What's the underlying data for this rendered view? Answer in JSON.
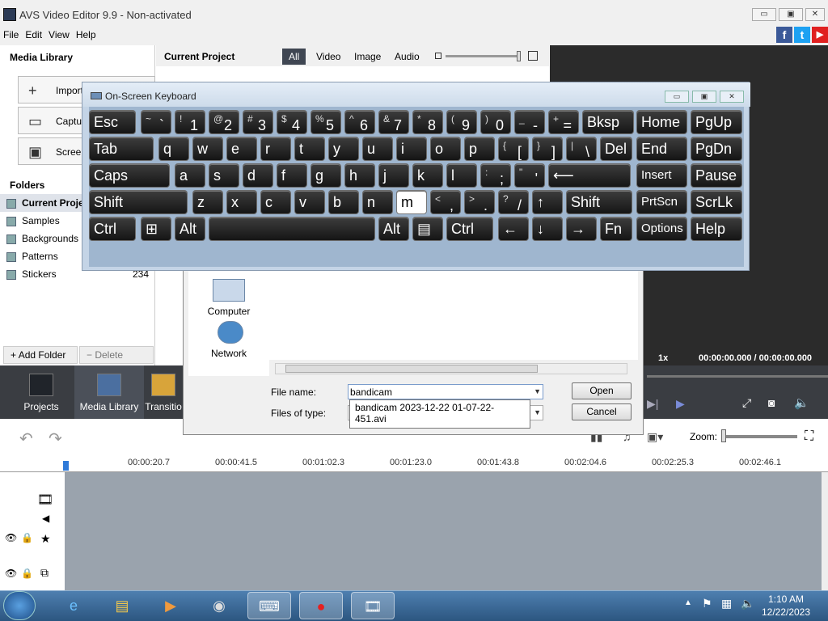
{
  "window": {
    "title": "AVS Video Editor 9.9 - Non-activated",
    "btn_min": "▭",
    "btn_max": "▣",
    "btn_close": "✕"
  },
  "menu": [
    "File",
    "Edit",
    "View",
    "Help"
  ],
  "social": {
    "fb": "f",
    "tw": "t",
    "yt": "▶",
    "fb_color": "#3b5998",
    "tw_color": "#1da1f2",
    "yt_color": "#e02020"
  },
  "media_library": {
    "title": "Media Library",
    "buttons": [
      "Import",
      "Capture",
      "Screen"
    ],
    "folders_title": "Folders",
    "folders": [
      {
        "name": "Current Project",
        "count": ""
      },
      {
        "name": "Samples",
        "count": ""
      },
      {
        "name": "Backgrounds",
        "count": ""
      },
      {
        "name": "Patterns",
        "count": ""
      },
      {
        "name": "Stickers",
        "count": "234"
      }
    ],
    "add_folder": "Add Folder",
    "delete_folder": "Delete Folder"
  },
  "project": {
    "title": "Current Project",
    "tabs": [
      "All",
      "Video",
      "Image",
      "Audio"
    ]
  },
  "bottom_tabs": [
    "Projects",
    "Media Library",
    "Transitio"
  ],
  "preview": {
    "speed": "1x",
    "time": "00:00:00.000 / 00:00:00.000"
  },
  "timeline": {
    "zoom_label": "Zoom:",
    "ticks": [
      "00:00:20.7",
      "00:00:41.5",
      "00:01:02.3",
      "00:01:23.0",
      "00:01:43.8",
      "00:02:04.6",
      "00:02:25.3",
      "00:02:46.1"
    ]
  },
  "file_dialog": {
    "places": [
      "Computer",
      "Network"
    ],
    "file_name_label": "File name:",
    "file_name_value": "bandicam",
    "files_of_type_label": "Files of type:",
    "autocomplete": "bandicam 2023-12-22 01-07-22-451.avi",
    "open": "Open",
    "cancel": "Cancel"
  },
  "osk": {
    "title": "On-Screen Keyboard",
    "rows": [
      [
        [
          "Esc",
          ""
        ],
        [
          "~",
          "`"
        ],
        [
          "!",
          "1"
        ],
        [
          "@",
          "2"
        ],
        [
          "#",
          "3"
        ],
        [
          "$",
          "4"
        ],
        [
          "%",
          "5"
        ],
        [
          "^",
          "6"
        ],
        [
          "&",
          "7"
        ],
        [
          "*",
          "8"
        ],
        [
          "(",
          "9"
        ],
        [
          ")",
          "0"
        ],
        [
          "_",
          "-"
        ],
        [
          "+",
          "="
        ],
        [
          "Bksp",
          ""
        ],
        [
          "Home",
          ""
        ],
        [
          "PgUp",
          ""
        ]
      ],
      [
        [
          "Tab",
          ""
        ],
        [
          "q",
          ""
        ],
        [
          "w",
          ""
        ],
        [
          "e",
          ""
        ],
        [
          "r",
          ""
        ],
        [
          "t",
          ""
        ],
        [
          "y",
          ""
        ],
        [
          "u",
          ""
        ],
        [
          "i",
          ""
        ],
        [
          "o",
          ""
        ],
        [
          "p",
          ""
        ],
        [
          "{",
          "["
        ],
        [
          "}",
          "]"
        ],
        [
          "|",
          "\\"
        ],
        [
          "Del",
          ""
        ],
        [
          "End",
          ""
        ],
        [
          "PgDn",
          ""
        ]
      ],
      [
        [
          "Caps",
          ""
        ],
        [
          "a",
          ""
        ],
        [
          "s",
          ""
        ],
        [
          "d",
          ""
        ],
        [
          "f",
          ""
        ],
        [
          "g",
          ""
        ],
        [
          "h",
          ""
        ],
        [
          "j",
          ""
        ],
        [
          "k",
          ""
        ],
        [
          "l",
          ""
        ],
        [
          ":",
          ";"
        ],
        [
          "\"",
          "'"
        ],
        [
          "⟵",
          ""
        ],
        [
          "Insert",
          ""
        ],
        [
          "Pause",
          ""
        ]
      ],
      [
        [
          "Shift",
          ""
        ],
        [
          "z",
          ""
        ],
        [
          "x",
          ""
        ],
        [
          "c",
          ""
        ],
        [
          "v",
          ""
        ],
        [
          "b",
          ""
        ],
        [
          "n",
          ""
        ],
        [
          "m",
          ""
        ],
        [
          "<",
          ","
        ],
        [
          ">",
          "."
        ],
        [
          "?",
          "/"
        ],
        [
          "↑",
          ""
        ],
        [
          "Shift",
          ""
        ],
        [
          "PrtScn",
          ""
        ],
        [
          "ScrLk",
          ""
        ]
      ],
      [
        [
          "Ctrl",
          ""
        ],
        [
          "⊞",
          ""
        ],
        [
          "Alt",
          ""
        ],
        [
          "",
          ""
        ],
        [
          "Alt",
          ""
        ],
        [
          "▤",
          ""
        ],
        [
          "Ctrl",
          ""
        ],
        [
          "←",
          ""
        ],
        [
          "↓",
          ""
        ],
        [
          "→",
          ""
        ],
        [
          "Fn",
          ""
        ],
        [
          "Options",
          ""
        ],
        [
          "Help",
          ""
        ]
      ]
    ]
  },
  "clock": {
    "time": "1:10 AM",
    "date": "12/22/2023"
  }
}
